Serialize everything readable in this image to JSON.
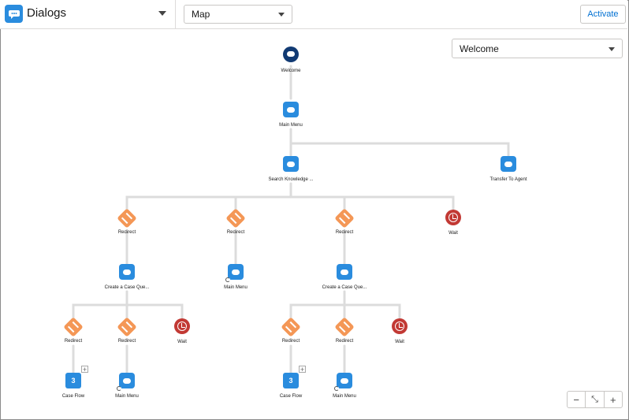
{
  "header": {
    "app_title": "Dialogs",
    "view_select": "Map",
    "activate_label": "Activate"
  },
  "dialog_select": {
    "value": "Welcome"
  },
  "nodes": {
    "welcome": "Welcome",
    "main_menu": "Main Menu",
    "search_knowledge": "Search Knowledge ...",
    "transfer": "Transfer To Agent",
    "redirect_1": "Redirect",
    "redirect_2": "Redirect",
    "redirect_3": "Redirect",
    "wait_1": "Wait",
    "case_q_1": "Create a Case Que...",
    "main_menu_2": "Main Menu",
    "case_q_2": "Create a Case Que...",
    "redirect_4": "Redirect",
    "redirect_5": "Redirect",
    "wait_2": "Wait",
    "redirect_6": "Redirect",
    "redirect_7": "Redirect",
    "wait_3": "Wait",
    "case_flow_1": "Case Flow",
    "case_flow_1_count": "3",
    "main_menu_3": "Main Menu",
    "case_flow_2": "Case Flow",
    "case_flow_2_count": "3",
    "main_menu_4": "Main Menu"
  },
  "zoom": {
    "minus": "−",
    "fit": "⤡",
    "plus": "+"
  }
}
